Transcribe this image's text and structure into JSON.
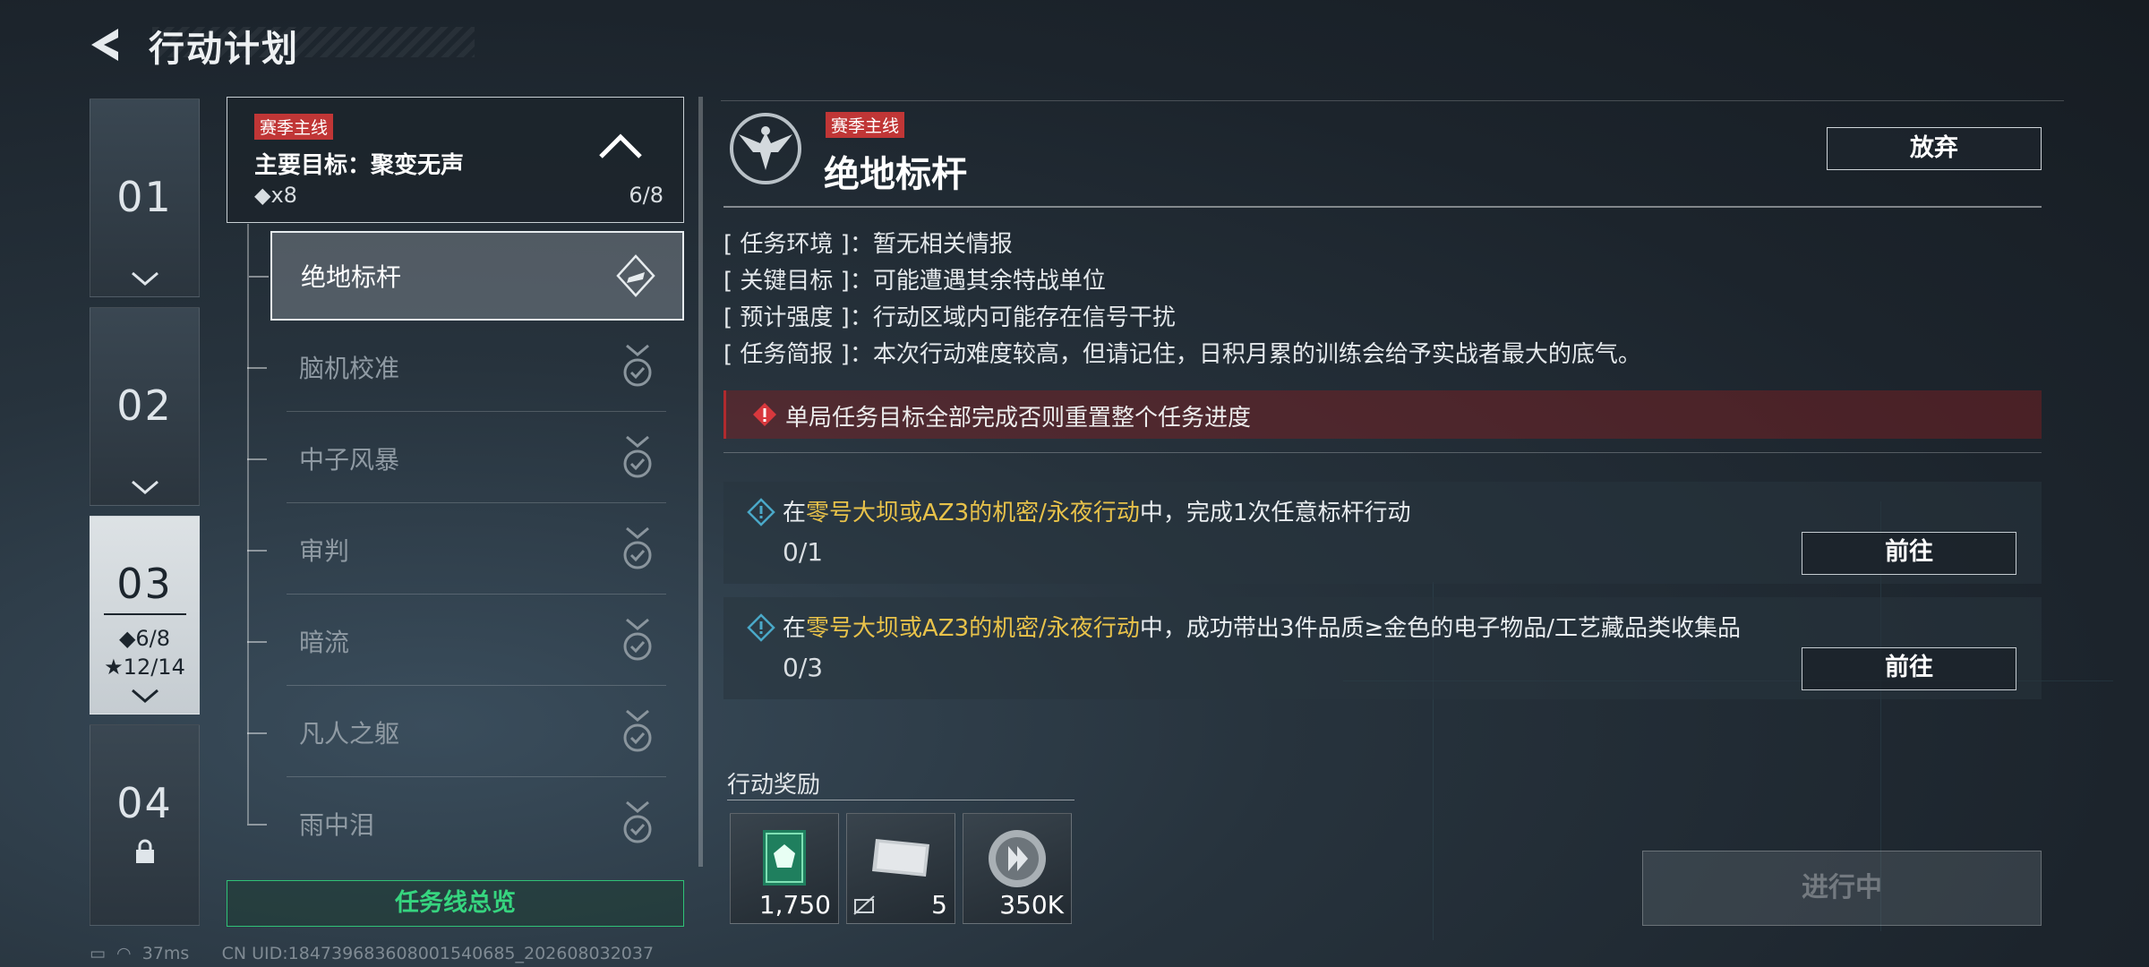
{
  "header": {
    "title": "行动计划"
  },
  "chapters": [
    {
      "num": "01"
    },
    {
      "num": "02"
    },
    {
      "num": "03",
      "stat_diamond": "◆6/8",
      "stat_star": "★12/14"
    },
    {
      "num": "04"
    }
  ],
  "main_target": {
    "tag": "赛季主线",
    "text": "主要目标：聚变无声",
    "count": "◆x8",
    "progress": "6/8"
  },
  "tasks": [
    {
      "label": "绝地标杆"
    },
    {
      "label": "脑机校准"
    },
    {
      "label": "中子风暴"
    },
    {
      "label": "审判"
    },
    {
      "label": "暗流"
    },
    {
      "label": "凡人之躯"
    },
    {
      "label": "雨中泪"
    }
  ],
  "overview_label": "任务线总览",
  "detail": {
    "tag": "赛季主线",
    "title": "绝地标杆",
    "abandon_label": "放弃",
    "info": [
      {
        "key": "[ 任务环境 ]",
        "value": "暂无相关情报"
      },
      {
        "key": "[ 关键目标 ]",
        "value": "可能遭遇其余特战单位"
      },
      {
        "key": "[ 预计强度 ]",
        "value": "行动区域内可能存在信号干扰"
      },
      {
        "key": "[ 任务简报 ]",
        "value": "本次行动难度较高，但请记住，日积月累的训练会给予实战者最大的底气。"
      }
    ],
    "warning": "单局任务目标全部完成否则重置整个任务进度",
    "objectives": [
      {
        "pre": "在",
        "hl": "零号大坝或AZ3的机密/永夜行动",
        "post": "中，完成1次任意标杆行动",
        "progress": "0/1",
        "go_label": "前往"
      },
      {
        "pre": "在",
        "hl": "零号大坝或AZ3的机密/永夜行动",
        "post": "中，成功带出3件品质≥金色的电子物品/工艺藏品类收集品",
        "progress": "0/3",
        "go_label": "前往"
      }
    ],
    "rewards_label": "行动奖励",
    "rewards": [
      {
        "icon": "green-badge-icon",
        "qty": "1,750"
      },
      {
        "icon": "silver-card-icon",
        "qty": "5"
      },
      {
        "icon": "silver-coin-icon",
        "qty": "350K"
      }
    ],
    "status_button": "进行中"
  },
  "status_bar": {
    "ping": "37ms",
    "uid": "CN UID:18473968360800154068​5_202608032037"
  },
  "colors": {
    "accent_green": "#36d57f",
    "tag_red": "#c03636",
    "highlight_yellow": "#e8c24a"
  }
}
